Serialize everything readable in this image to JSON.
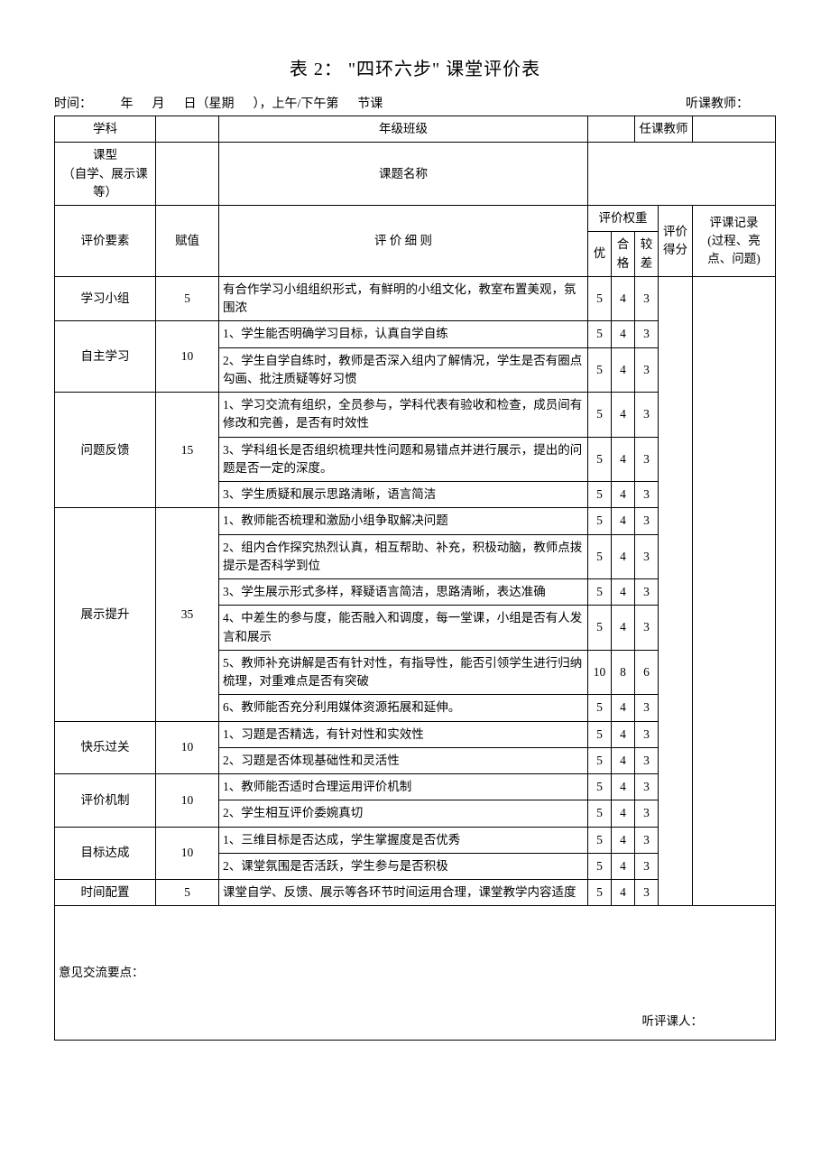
{
  "title": "表 2：  \"四环六步\" 课堂评价表",
  "meta": {
    "time_prefix": "时间：",
    "year_suffix": "年",
    "month_suffix": "月",
    "day_suffix": "日（星期",
    "weekday_close": "），上午/下午第",
    "period_suffix": "节课",
    "listen_teacher_label": "听课教师："
  },
  "header_row1": {
    "subject_label": "学科",
    "grade_label": "年级班级",
    "teacher_label": "任课教师"
  },
  "header_row2": {
    "type_label": "课型",
    "type_hint": "（自学、展示课等）",
    "topic_label": "课题名称"
  },
  "columns": {
    "element": "评价要素",
    "value": "赋值",
    "rule": "评    价    细    则",
    "weight_group": "评价权重",
    "excellent": "优",
    "pass": "合格",
    "poor": "较差",
    "score": "评价得分",
    "note": "评课记录",
    "note_hint": "(过程、亮点、问题)"
  },
  "sections": [
    {
      "name": "学习小组",
      "value": "5",
      "rows": [
        {
          "text": "  有合作学习小组组织形式，有鲜明的小组文化，教室布置美观，氛围浓",
          "w": [
            "5",
            "4",
            "3"
          ]
        }
      ]
    },
    {
      "name": "自主学习",
      "value": "10",
      "rows": [
        {
          "text": "1、学生能否明确学习目标，认真自学自练",
          "w": [
            "5",
            "4",
            "3"
          ]
        },
        {
          "text": "2、学生自学自练时，教师是否深入组内了解情况，学生是否有圈点勾画、批注质疑等好习惯",
          "w": [
            "5",
            "4",
            "3"
          ]
        }
      ]
    },
    {
      "name": "问题反馈",
      "value": "15",
      "rows": [
        {
          "text": "1、学习交流有组织，全员参与，学科代表有验收和检查，成员间有修改和完善，是否有时效性",
          "w": [
            "5",
            "4",
            "3"
          ]
        },
        {
          "text": "3、学科组长是否组织梳理共性问题和易错点并进行展示，提出的问题是否一定的深度。",
          "w": [
            "5",
            "4",
            "3"
          ]
        },
        {
          "text": "3、学生质疑和展示思路清晰，语言简洁",
          "w": [
            "5",
            "4",
            "3"
          ]
        }
      ]
    },
    {
      "name": "展示提升",
      "value": "35",
      "rows": [
        {
          "text": "1、教师能否梳理和激励小组争取解决问题",
          "w": [
            "5",
            "4",
            "3"
          ]
        },
        {
          "text": "2、组内合作探究热烈认真，相互帮助、补充，积极动脑，教师点拨提示是否科学到位",
          "w": [
            "5",
            "4",
            "3"
          ]
        },
        {
          "text": "3、学生展示形式多样，释疑语言简洁，思路清晰，表达准确",
          "w": [
            "5",
            "4",
            "3"
          ]
        },
        {
          "text": "4、中差生的参与度，能否融入和调度，每一堂课，小组是否有人发言和展示",
          "w": [
            "5",
            "4",
            "3"
          ]
        },
        {
          "text": "5、教师补充讲解是否有针对性，有指导性，能否引领学生进行归纳梳理，对重难点是否有突破",
          "w": [
            "10",
            "8",
            "6"
          ]
        },
        {
          "text": "6、教师能否充分利用媒体资源拓展和延伸。",
          "w": [
            "5",
            "4",
            "3"
          ]
        }
      ]
    },
    {
      "name": "快乐过关",
      "value": "10",
      "rows": [
        {
          "text": "1、习题是否精选，有针对性和实效性",
          "w": [
            "5",
            "4",
            "3"
          ]
        },
        {
          "text": "2、习题是否体现基础性和灵活性",
          "w": [
            "5",
            "4",
            "3"
          ]
        }
      ]
    },
    {
      "name": "评价机制",
      "value": "10",
      "rows": [
        {
          "text": "1、教师能否适时合理运用评价机制",
          "w": [
            "5",
            "4",
            "3"
          ]
        },
        {
          "text": "2、学生相互评价委婉真切",
          "w": [
            "5",
            "4",
            "3"
          ]
        }
      ]
    },
    {
      "name": "目标达成",
      "value": "10",
      "rows": [
        {
          "text": "1、三维目标是否达成，学生掌握度是否优秀",
          "w": [
            "5",
            "4",
            "3"
          ]
        },
        {
          "text": "2、课堂氛围是否活跃，学生参与是否积极",
          "w": [
            "5",
            "4",
            "3"
          ]
        }
      ]
    },
    {
      "name": "时间配置",
      "value": "5",
      "rows": [
        {
          "text": "  课堂自学、反馈、展示等各环节时间运用合理，课堂教学内容适度",
          "w": [
            "5",
            "4",
            "3"
          ]
        }
      ]
    }
  ],
  "footer": {
    "label": "意见交流要点：",
    "signature": "听评课人："
  }
}
